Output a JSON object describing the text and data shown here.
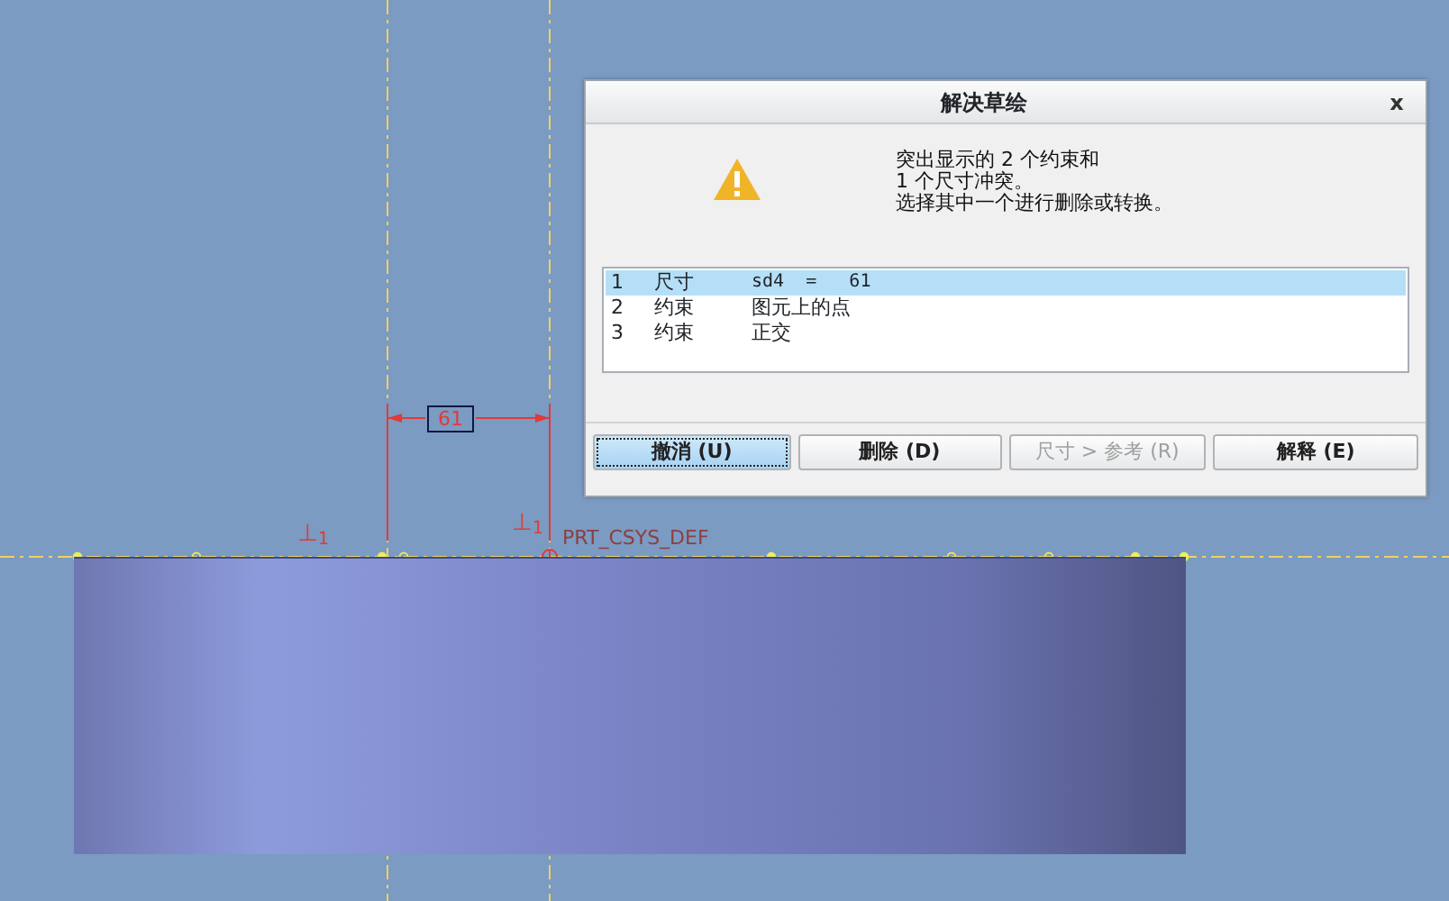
{
  "canvas": {
    "dimension": "61",
    "constraint_marks": [
      "⊥$_{1}$",
      "⊥$_{1}$"
    ],
    "csys_label": "PRT_CSYS_DEF"
  },
  "dialog": {
    "title": "解决草绘",
    "close": "x",
    "message": [
      "突出显示的 2 个约束和",
      "1 个尺寸冲突。",
      "选择其中一个进行删除或转换。"
    ],
    "items": [
      {
        "number": "1",
        "type": "尺寸",
        "detail": "sd4  =   61",
        "selected": true
      },
      {
        "number": "2",
        "type": "约束",
        "detail": "图元上的点",
        "selected": false
      },
      {
        "number": "3",
        "type": "约束",
        "detail": "正交",
        "selected": false
      }
    ],
    "buttons": [
      {
        "label": "撤消 (U)",
        "disabled": false,
        "focused": true
      },
      {
        "label": "删除 (D)",
        "disabled": false,
        "focused": false
      },
      {
        "label": "尺寸 > 参考 (R)",
        "disabled": true,
        "focused": false
      },
      {
        "label": "解释 (E)",
        "disabled": false,
        "focused": false
      }
    ]
  }
}
